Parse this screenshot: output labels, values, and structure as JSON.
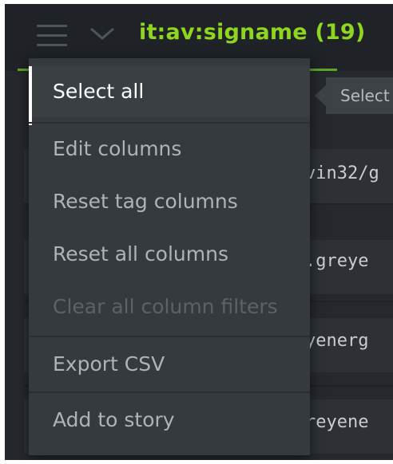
{
  "header": {
    "title": "it:av:signame (19)",
    "accent_color": "#8fd61e",
    "menu_icon": "hamburger-icon",
    "dropdown_icon": "chevron-down-icon"
  },
  "tooltip": {
    "label": "Select"
  },
  "table": {
    "rows": [
      "vin32/g",
      ".greye",
      "yenerg",
      "reyene"
    ]
  },
  "menu": {
    "items": [
      {
        "label": "Select all",
        "state": "active"
      },
      {
        "label": "Edit columns",
        "state": "enabled"
      },
      {
        "label": "Reset tag columns",
        "state": "enabled"
      },
      {
        "label": "Reset all columns",
        "state": "enabled"
      },
      {
        "label": "Clear all column filters",
        "state": "disabled"
      },
      {
        "label": "Export CSV",
        "state": "enabled"
      },
      {
        "label": "Add to story",
        "state": "enabled"
      }
    ]
  }
}
